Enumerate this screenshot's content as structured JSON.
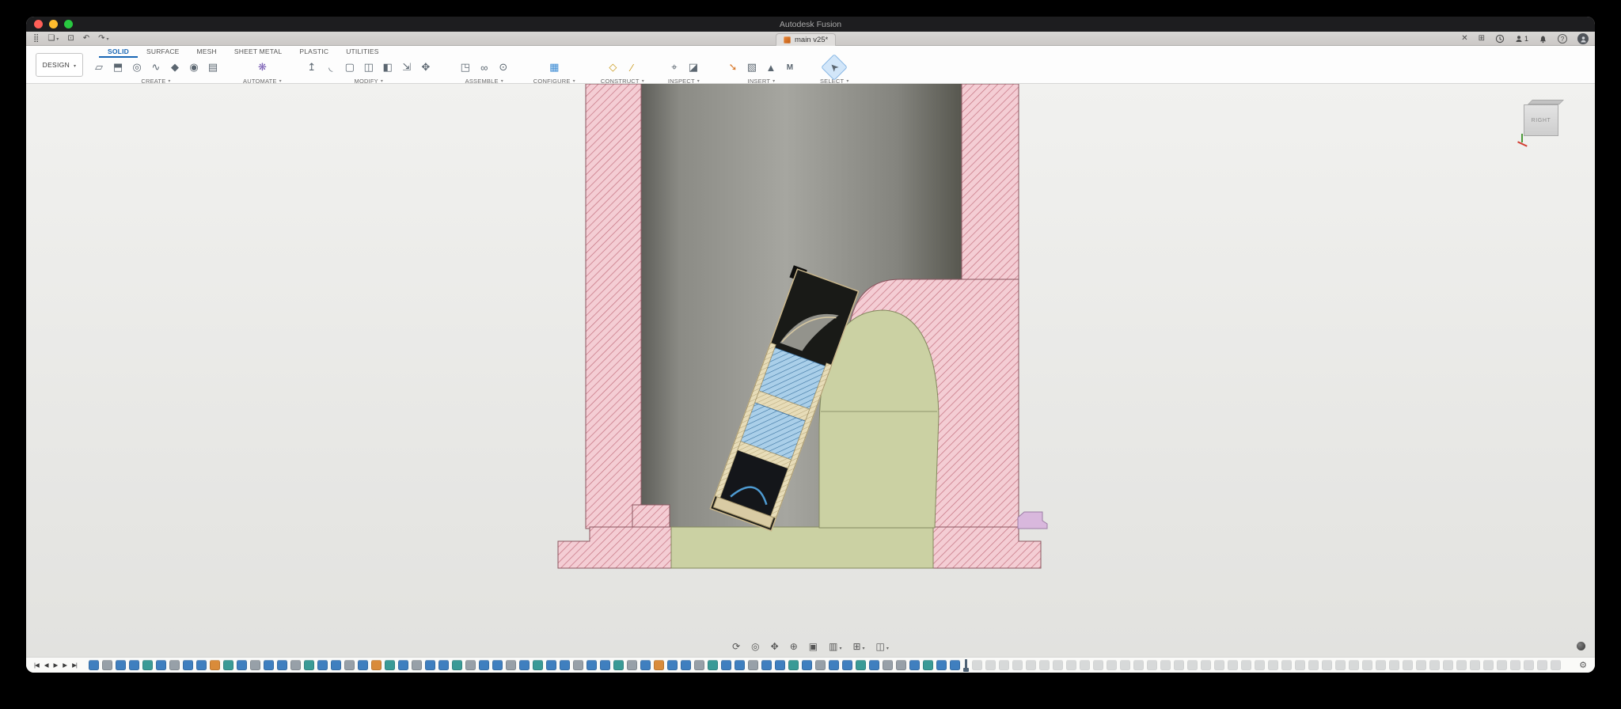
{
  "titlebar": {
    "title": "Autodesk Fusion"
  },
  "tabstrip": {
    "left_icons": [
      {
        "name": "apps-grid-icon",
        "glyph": "⣿"
      },
      {
        "name": "file-menu-icon",
        "glyph": "❏",
        "caret": true
      },
      {
        "name": "save-icon",
        "glyph": "⊡"
      },
      {
        "name": "undo-icon",
        "glyph": "↶"
      },
      {
        "name": "redo-icon",
        "glyph": "↷",
        "caret": true
      }
    ],
    "document_tab": {
      "label": "main v25*"
    },
    "right": {
      "close_glyph": "✕",
      "extensions_glyph": "⊞",
      "collaboration_count": "1",
      "help_glyph": "?"
    }
  },
  "toolbar": {
    "workspace_label": "DESIGN",
    "ribbon_tabs": [
      {
        "label": "SOLID",
        "active": true
      },
      {
        "label": "SURFACE"
      },
      {
        "label": "MESH"
      },
      {
        "label": "SHEET METAL"
      },
      {
        "label": "PLASTIC"
      },
      {
        "label": "UTILITIES"
      }
    ],
    "groups": [
      {
        "label": "CREATE",
        "icons": [
          {
            "name": "create-sketch-icon",
            "glyph": "▱"
          },
          {
            "name": "extrude-icon",
            "glyph": "⬒"
          },
          {
            "name": "revolve-icon",
            "glyph": "◎"
          },
          {
            "name": "sweep-icon",
            "glyph": "∿"
          },
          {
            "name": "loft-icon",
            "glyph": "◆"
          },
          {
            "name": "hole-icon",
            "glyph": "◉"
          },
          {
            "name": "pattern-icon",
            "glyph": "▤"
          }
        ]
      },
      {
        "label": "AUTOMATE",
        "icons": [
          {
            "name": "automate-icon",
            "glyph": "❋",
            "c": "#7a5fb5"
          }
        ]
      },
      {
        "label": "MODIFY",
        "icons": [
          {
            "name": "press-pull-icon",
            "glyph": "↥"
          },
          {
            "name": "fillet-icon",
            "glyph": "◟"
          },
          {
            "name": "shell-icon",
            "glyph": "▢"
          },
          {
            "name": "combine-icon",
            "glyph": "◫"
          },
          {
            "name": "split-body-icon",
            "glyph": "◧"
          },
          {
            "name": "scale-icon",
            "glyph": "⇲"
          },
          {
            "name": "move-copy-icon",
            "glyph": "✥"
          }
        ]
      },
      {
        "label": "ASSEMBLE",
        "icons": [
          {
            "name": "new-component-icon",
            "glyph": "◳"
          },
          {
            "name": "joint-icon",
            "glyph": "∞"
          },
          {
            "name": "as-built-joint-icon",
            "glyph": "⊙"
          }
        ]
      },
      {
        "label": "CONFIGURE",
        "icons": [
          {
            "name": "configure-icon",
            "glyph": "▦",
            "c": "#3b8bd4"
          }
        ]
      },
      {
        "label": "CONSTRUCT",
        "icons": [
          {
            "name": "construction-plane-icon",
            "glyph": "◇",
            "c": "#c99a1e"
          },
          {
            "name": "construction-axis-icon",
            "glyph": "∕",
            "c": "#c99a1e"
          }
        ]
      },
      {
        "label": "INSPECT",
        "icons": [
          {
            "name": "measure-icon",
            "glyph": "⌖"
          },
          {
            "name": "section-analysis-icon",
            "glyph": "◪"
          }
        ]
      },
      {
        "label": "INSERT",
        "icons": [
          {
            "name": "insert-derive-icon",
            "glyph": "➘",
            "c": "#d97b2e"
          },
          {
            "name": "decal-icon",
            "glyph": "▧"
          },
          {
            "name": "insert-mesh-icon",
            "glyph": "▲"
          },
          {
            "name": "insert-mcmaster-icon",
            "glyph": "M",
            "small": true
          }
        ]
      },
      {
        "label": "SELECT",
        "icons": [
          {
            "name": "select-cursor-icon",
            "glyph": "➤",
            "rot": -135,
            "hl": true
          }
        ]
      }
    ]
  },
  "canvas": {
    "viewcube_label": "RIGHT"
  },
  "navbar": {
    "icons": [
      {
        "name": "orbit-icon",
        "glyph": "⟳"
      },
      {
        "name": "look-at-icon",
        "glyph": "◎"
      },
      {
        "name": "pan-icon",
        "glyph": "✥"
      },
      {
        "name": "zoom-icon",
        "glyph": "⊕"
      },
      {
        "name": "fit-icon",
        "glyph": "▣"
      },
      {
        "name": "display-settings-icon",
        "glyph": "▥",
        "caret": true
      },
      {
        "name": "grid-snaps-icon",
        "glyph": "⊞",
        "caret": true
      },
      {
        "name": "viewports-icon",
        "glyph": "◫",
        "caret": true
      }
    ]
  },
  "timeline": {
    "controls": [
      {
        "name": "timeline-goto-start-button",
        "glyph": "|◀"
      },
      {
        "name": "timeline-step-back-button",
        "glyph": "◀"
      },
      {
        "name": "timeline-play-button",
        "glyph": "▶"
      },
      {
        "name": "timeline-step-forward-button",
        "glyph": "▶"
      },
      {
        "name": "timeline-goto-end-button",
        "glyph": "▶|"
      }
    ],
    "active_pattern": "bgbbtbgbbotbgbbgtbbgbotbgbbtgbbgbtbbgbbtgbobbgtbbgbbtbgbbtbggbtbb",
    "inactive_count": 44,
    "type_colors": {
      "b": "#3f7fbf",
      "t": "#3a9a96",
      "g": "#97a0a8",
      "o": "#d98b3a"
    },
    "settings_glyph": "⚙"
  },
  "colors": {
    "accent_blue": "#1866b4",
    "hatch_pink_bg": "#f4cdd4",
    "hatch_pink_line": "#c4717f",
    "part_blue_bg": "#aacfe9",
    "part_blue_line": "#39729f",
    "part_green": "#cbd1a3",
    "part_tan": "#e7dcb8",
    "part_lavender": "#d9b8dd",
    "bore_gray": "#8e8e89"
  }
}
